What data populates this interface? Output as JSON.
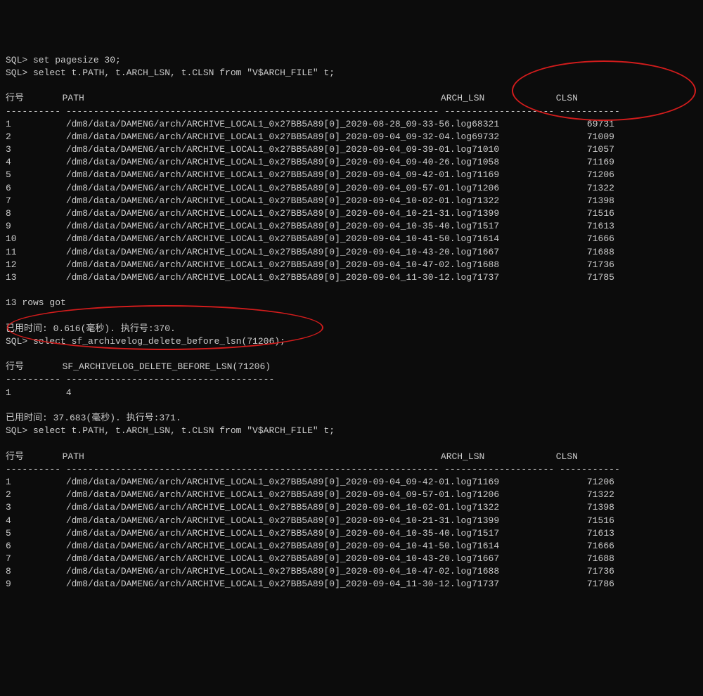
{
  "lines": {
    "cmd1": "SQL> set pagesize 30;",
    "cmd2": "SQL> select t.PATH, t.ARCH_LSN, t.CLSN from \"V$ARCH_FILE\" t;",
    "blank": "",
    "hdr1": "行号       PATH                                                                 ARCH_LSN             CLSN",
    "dash1": "---------- -------------------------------------------------------------------- -------------------- -----------",
    "footer1": "13 rows got",
    "time1": "已用时间: 0.616(毫秒). 执行号:370.",
    "cmd3": "SQL> select sf_archivelog_delete_before_lsn(71206);",
    "hdr2": "行号       SF_ARCHIVELOG_DELETE_BEFORE_LSN(71206)",
    "dash2": "---------- --------------------------------------",
    "r2_1": "1          4",
    "time2": "已用时间: 37.683(毫秒). 执行号:371.",
    "cmd4": "SQL> select t.PATH, t.ARCH_LSN, t.CLSN from \"V$ARCH_FILE\" t;",
    "hdr3": "行号       PATH                                                                 ARCH_LSN             CLSN",
    "dash3": "---------- -------------------------------------------------------------------- -------------------- -----------"
  },
  "table1": [
    {
      "n": "1",
      "path": "/dm8/data/DAMENG/arch/ARCHIVE_LOCAL1_0x27BB5A89[0]_2020-08-28_09-33-56.log",
      "lsn": "68321",
      "clsn": "69731"
    },
    {
      "n": "2",
      "path": "/dm8/data/DAMENG/arch/ARCHIVE_LOCAL1_0x27BB5A89[0]_2020-09-04_09-32-04.log",
      "lsn": "69732",
      "clsn": "71009"
    },
    {
      "n": "3",
      "path": "/dm8/data/DAMENG/arch/ARCHIVE_LOCAL1_0x27BB5A89[0]_2020-09-04_09-39-01.log",
      "lsn": "71010",
      "clsn": "71057"
    },
    {
      "n": "4",
      "path": "/dm8/data/DAMENG/arch/ARCHIVE_LOCAL1_0x27BB5A89[0]_2020-09-04_09-40-26.log",
      "lsn": "71058",
      "clsn": "71169"
    },
    {
      "n": "5",
      "path": "/dm8/data/DAMENG/arch/ARCHIVE_LOCAL1_0x27BB5A89[0]_2020-09-04_09-42-01.log",
      "lsn": "71169",
      "clsn": "71206"
    },
    {
      "n": "6",
      "path": "/dm8/data/DAMENG/arch/ARCHIVE_LOCAL1_0x27BB5A89[0]_2020-09-04_09-57-01.log",
      "lsn": "71206",
      "clsn": "71322"
    },
    {
      "n": "7",
      "path": "/dm8/data/DAMENG/arch/ARCHIVE_LOCAL1_0x27BB5A89[0]_2020-09-04_10-02-01.log",
      "lsn": "71322",
      "clsn": "71398"
    },
    {
      "n": "8",
      "path": "/dm8/data/DAMENG/arch/ARCHIVE_LOCAL1_0x27BB5A89[0]_2020-09-04_10-21-31.log",
      "lsn": "71399",
      "clsn": "71516"
    },
    {
      "n": "9",
      "path": "/dm8/data/DAMENG/arch/ARCHIVE_LOCAL1_0x27BB5A89[0]_2020-09-04_10-35-40.log",
      "lsn": "71517",
      "clsn": "71613"
    },
    {
      "n": "10",
      "path": "/dm8/data/DAMENG/arch/ARCHIVE_LOCAL1_0x27BB5A89[0]_2020-09-04_10-41-50.log",
      "lsn": "71614",
      "clsn": "71666"
    },
    {
      "n": "11",
      "path": "/dm8/data/DAMENG/arch/ARCHIVE_LOCAL1_0x27BB5A89[0]_2020-09-04_10-43-20.log",
      "lsn": "71667",
      "clsn": "71688"
    },
    {
      "n": "12",
      "path": "/dm8/data/DAMENG/arch/ARCHIVE_LOCAL1_0x27BB5A89[0]_2020-09-04_10-47-02.log",
      "lsn": "71688",
      "clsn": "71736"
    },
    {
      "n": "13",
      "path": "/dm8/data/DAMENG/arch/ARCHIVE_LOCAL1_0x27BB5A89[0]_2020-09-04_11-30-12.log",
      "lsn": "71737",
      "clsn": "71785"
    }
  ],
  "table3": [
    {
      "n": "1",
      "path": "/dm8/data/DAMENG/arch/ARCHIVE_LOCAL1_0x27BB5A89[0]_2020-09-04_09-42-01.log",
      "lsn": "71169",
      "clsn": "71206"
    },
    {
      "n": "2",
      "path": "/dm8/data/DAMENG/arch/ARCHIVE_LOCAL1_0x27BB5A89[0]_2020-09-04_09-57-01.log",
      "lsn": "71206",
      "clsn": "71322"
    },
    {
      "n": "3",
      "path": "/dm8/data/DAMENG/arch/ARCHIVE_LOCAL1_0x27BB5A89[0]_2020-09-04_10-02-01.log",
      "lsn": "71322",
      "clsn": "71398"
    },
    {
      "n": "4",
      "path": "/dm8/data/DAMENG/arch/ARCHIVE_LOCAL1_0x27BB5A89[0]_2020-09-04_10-21-31.log",
      "lsn": "71399",
      "clsn": "71516"
    },
    {
      "n": "5",
      "path": "/dm8/data/DAMENG/arch/ARCHIVE_LOCAL1_0x27BB5A89[0]_2020-09-04_10-35-40.log",
      "lsn": "71517",
      "clsn": "71613"
    },
    {
      "n": "6",
      "path": "/dm8/data/DAMENG/arch/ARCHIVE_LOCAL1_0x27BB5A89[0]_2020-09-04_10-41-50.log",
      "lsn": "71614",
      "clsn": "71666"
    },
    {
      "n": "7",
      "path": "/dm8/data/DAMENG/arch/ARCHIVE_LOCAL1_0x27BB5A89[0]_2020-09-04_10-43-20.log",
      "lsn": "71667",
      "clsn": "71688"
    },
    {
      "n": "8",
      "path": "/dm8/data/DAMENG/arch/ARCHIVE_LOCAL1_0x27BB5A89[0]_2020-09-04_10-47-02.log",
      "lsn": "71688",
      "clsn": "71736"
    },
    {
      "n": "9",
      "path": "/dm8/data/DAMENG/arch/ARCHIVE_LOCAL1_0x27BB5A89[0]_2020-09-04_11-30-12.log",
      "lsn": "71737",
      "clsn": "71786"
    }
  ]
}
